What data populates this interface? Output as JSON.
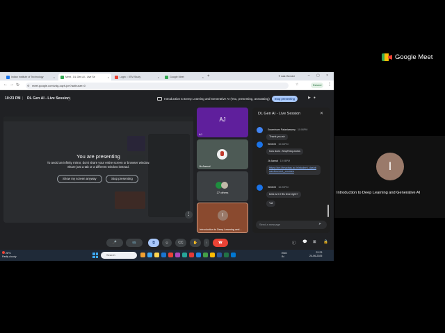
{
  "side_panel": {
    "brand": "Google Meet",
    "avatar_initial": "I",
    "participant_name": "Introduction to Deep Learning and Generative AI"
  },
  "browser": {
    "tabs": [
      {
        "label": "Indian Institute of Technology",
        "color": "#1a73e8"
      },
      {
        "label": "Meet - DL Gen AI - Live Se",
        "color": "#34a853"
      },
      {
        "label": "Login :: IITM Study",
        "color": "#ea4335"
      },
      {
        "label": "Google Meet",
        "color": "#34a853"
      }
    ],
    "new_tab": "+",
    "ask_gemini": "Ask Gemini",
    "url": "meet.google.com/vdg-cqzh-jve?authuser=0",
    "profile_label": "Eshanvi"
  },
  "meet": {
    "time": "10:23 PM",
    "separator": "|",
    "meeting_title": "DL Gen AI - Live Session",
    "presenting_banner": "Introduction to Deep Learning and Generative AI (You, presenting, annotating)",
    "stop_presenting_top": "Stop presenting",
    "presenting": {
      "heading": "You are presenting",
      "desc_line1": "To avoid an infinity mirror, don't share your entire screen or browser window.",
      "desc_line2": "Share just a tab or a different window instead.",
      "show_anyway": "Show my screen anyway",
      "stop": "Stop presenting"
    },
    "tiles": {
      "aj_initials": "AJ",
      "aj_label": "AJ",
      "ja_label": "Jb Aamal",
      "others_label": "27 others",
      "intro_initial": "I",
      "intro_label": "Introduction to Deep Learning and..."
    },
    "chat": {
      "title": "DL Gen AI - Live Session",
      "messages": [
        {
          "sender": "Swaminam Palanisawmy",
          "time": "10:06PM",
          "text": "Thank you sir",
          "avatar_color": "#4285f4",
          "link": false
        },
        {
          "sender": "SIDDHI",
          "time": "10:06PM",
          "text": "how does .Seq2Seq works",
          "avatar_color": "#1a73e8",
          "link": false
        },
        {
          "sender": "Jb Aamal",
          "time": "10:06PM",
          "text": "https://sm.iitmadras.ac.in/student_dashboard/current_courses",
          "avatar_color": "",
          "link": true
        },
        {
          "sender": "SIDDHI",
          "time": "10:20PM",
          "text": "beta is 0.9 ffo time right?",
          "avatar_color": "#1a73e8",
          "link": false
        },
        {
          "sender": "",
          "time": "",
          "text": "*all",
          "avatar_color": "",
          "link": false
        }
      ],
      "input_placeholder": "Send a message"
    },
    "controls": {
      "mic": "🎤",
      "cam": "📹",
      "present": "⧉",
      "emoji": "☺",
      "cc": "CC",
      "hand": "✋",
      "more": "⋮",
      "leave": "☎",
      "info": "ⓘ",
      "people": "👥",
      "chat_icon": "💬",
      "activities": "⊞",
      "lock": "🔒"
    }
  },
  "taskbar": {
    "temp": "28°C",
    "weather": "Partly cloudy",
    "search": "Search",
    "lang": "ENG",
    "region": "IN",
    "time": "22:23",
    "date": "24-06-2025"
  }
}
